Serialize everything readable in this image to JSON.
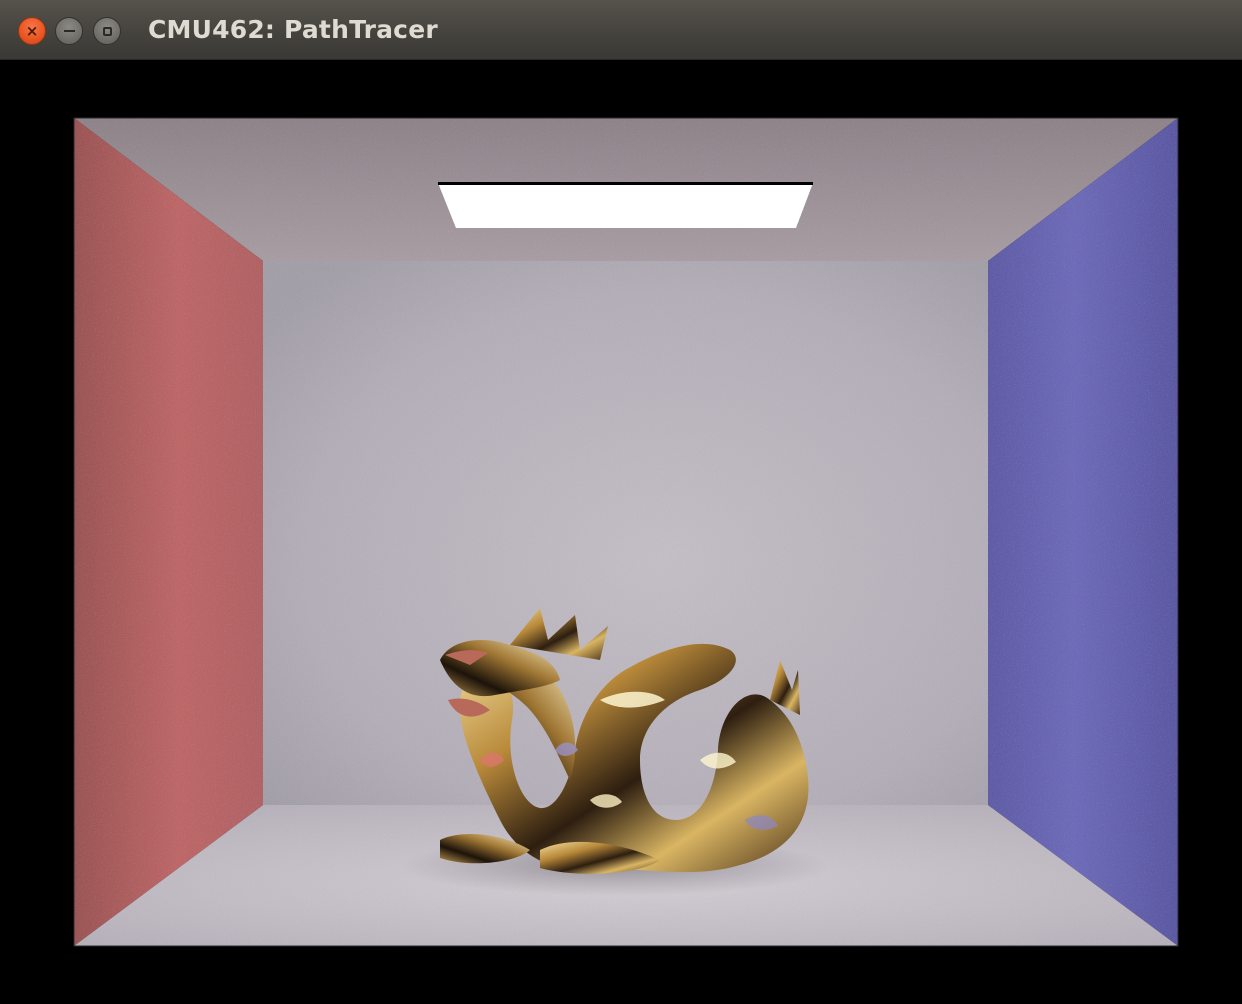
{
  "window": {
    "title": "CMU462: PathTracer"
  },
  "titlebar_buttons": {
    "close_icon": "close-icon",
    "minimize_icon": "minimize-icon",
    "maximize_icon": "maximize-icon",
    "close_glyph": "×"
  },
  "scene": {
    "left_wall_color": "#b86566",
    "right_wall_color": "#6b68b3",
    "back_wall_color": "#b8b3bb",
    "ceiling_color": "#9a8f96",
    "floor_color": "#c7c1c9",
    "light_color": "#ffffff",
    "dragon_color": "#c7a54a"
  }
}
